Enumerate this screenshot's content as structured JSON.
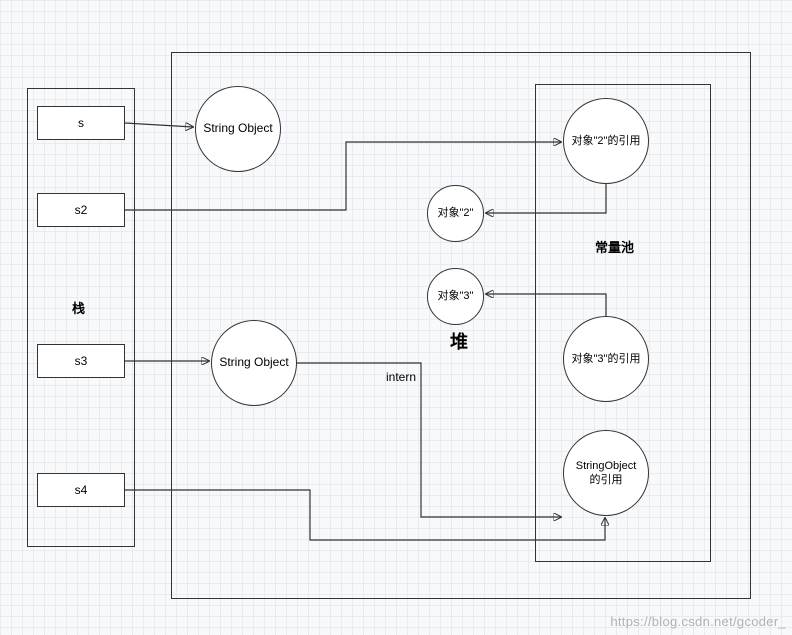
{
  "stack": {
    "label": "栈",
    "vars": [
      "s",
      "s2",
      "s3",
      "s4"
    ]
  },
  "heap": {
    "label": "堆",
    "stringObject1": "String Object",
    "stringObject2": "String Object",
    "obj2": "对象\"2\"",
    "obj3": "对象\"3\"",
    "internLabel": "intern"
  },
  "constantPool": {
    "label": "常量池",
    "ref2": "对象\"2\"的引用",
    "ref3": "对象\"3\"的引用",
    "refStringObject": "StringObject\n的引用"
  },
  "watermark": "https://blog.csdn.net/gcoder_"
}
